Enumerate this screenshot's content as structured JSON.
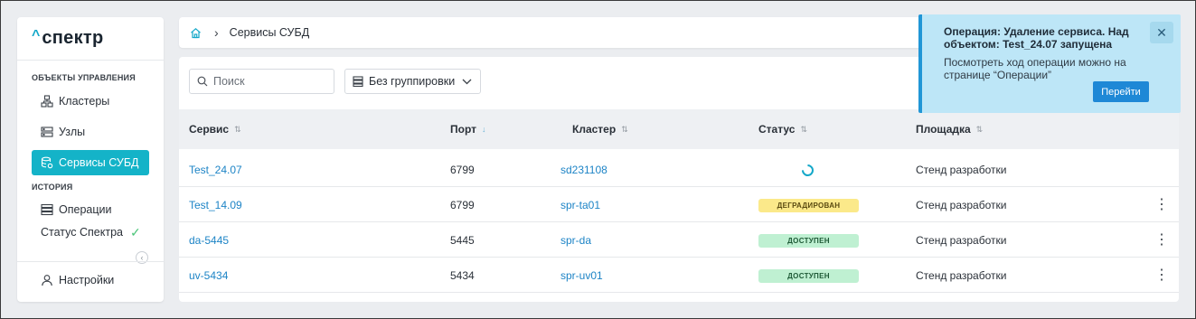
{
  "brand": {
    "mark": "^",
    "name": "спектр"
  },
  "sidebar": {
    "section_management": "ОБЪЕКТЫ УПРАВЛЕНИЯ",
    "items": [
      {
        "label": "Кластеры",
        "icon": "cluster-icon"
      },
      {
        "label": "Узлы",
        "icon": "server-icon"
      },
      {
        "label": "Сервисы СУБД",
        "icon": "database-icon",
        "active": true
      }
    ],
    "section_history": "ИСТОРИЯ",
    "history_items": [
      {
        "label": "Операции",
        "icon": "operations-icon"
      }
    ],
    "status_label": "Статус Спектра",
    "settings_label": "Настройки"
  },
  "breadcrumb": {
    "current": "Сервисы СУБД"
  },
  "toolbar": {
    "search_placeholder": "Поиск",
    "grouping_value": "Без группировки"
  },
  "table": {
    "columns": [
      "Сервис",
      "Порт",
      "Кластер",
      "Статус",
      "Площадка"
    ],
    "sorted_column": "Порт",
    "rows": [
      {
        "service": "Test_24.07",
        "port": "6799",
        "cluster": "sd231108",
        "status": "",
        "status_kind": "loading",
        "site": "Стенд разработки",
        "menu": false
      },
      {
        "service": "Test_14.09",
        "port": "6799",
        "cluster": "spr-ta01",
        "status": "ДЕГРАДИРОВАН",
        "status_kind": "warn",
        "site": "Стенд разработки",
        "menu": true
      },
      {
        "service": "da-5445",
        "port": "5445",
        "cluster": "spr-da",
        "status": "ДОСТУПЕН",
        "status_kind": "ok",
        "site": "Стенд разработки",
        "menu": true
      },
      {
        "service": "uv-5434",
        "port": "5434",
        "cluster": "spr-uv01",
        "status": "ДОСТУПЕН",
        "status_kind": "ok",
        "site": "Стенд разработки",
        "menu": true
      }
    ]
  },
  "toast": {
    "title": "Операция: Удаление сервиса. Над объектом: Test_24.07 запущена",
    "body": "Посмотреть ход операции можно на странице “Операции”",
    "action_label": "Перейти",
    "close_symbol": "✕"
  },
  "colors": {
    "accent": "#14b3c8",
    "link": "#1d84c6",
    "toast_bg": "#bde6f7",
    "badge_warn": "#fbe98a",
    "badge_ok": "#bff0d2"
  }
}
